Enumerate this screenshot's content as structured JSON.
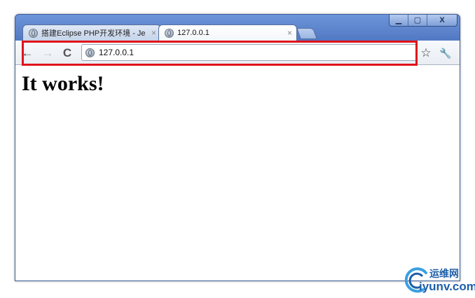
{
  "window": {
    "minimize_glyph": "▁",
    "maximize_glyph": "▢",
    "close_glyph": "X"
  },
  "tabs": [
    {
      "label": "搭建Eclipse PHP开发环境 - Je",
      "close_glyph": "×",
      "icon": "globe-icon"
    },
    {
      "label": "127.0.0.1",
      "close_glyph": "×",
      "icon": "globe-icon"
    }
  ],
  "toolbar": {
    "back_glyph": "←",
    "forward_glyph": "→",
    "reload_glyph": "C",
    "url": "127.0.0.1",
    "star_glyph": "☆",
    "wrench_glyph": "🔧"
  },
  "page": {
    "heading": "It works!"
  },
  "watermark": {
    "cn": "运维网",
    "en": "iyunv.com"
  },
  "colors": {
    "highlight": "#e0121a",
    "frame": "#5279c3",
    "watermark": "#1d5fa8"
  }
}
